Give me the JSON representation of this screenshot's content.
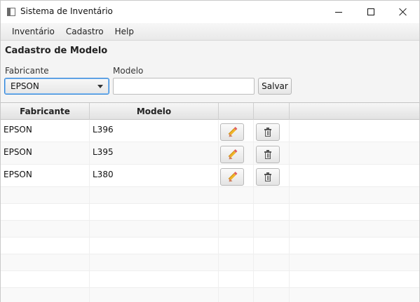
{
  "window": {
    "title": "Sistema de Inventário"
  },
  "menu": {
    "items": [
      "Inventário",
      "Cadastro",
      "Help"
    ]
  },
  "form": {
    "title": "Cadastro de Modelo",
    "fabricante_label": "Fabricante",
    "fabricante_value": "EPSON",
    "modelo_label": "Modelo",
    "modelo_value": "",
    "save_label": "Salvar"
  },
  "table": {
    "columns": [
      "Fabricante",
      "Modelo",
      "",
      "",
      ""
    ],
    "rows": [
      {
        "fabricante": "EPSON",
        "modelo": "L396"
      },
      {
        "fabricante": "EPSON",
        "modelo": "L395"
      },
      {
        "fabricante": "EPSON",
        "modelo": "L380"
      }
    ],
    "edit_icon": "pencil-icon",
    "delete_icon": "trash-icon"
  },
  "colors": {
    "accent": "#2f84d8",
    "pencil": "#f0b427"
  }
}
